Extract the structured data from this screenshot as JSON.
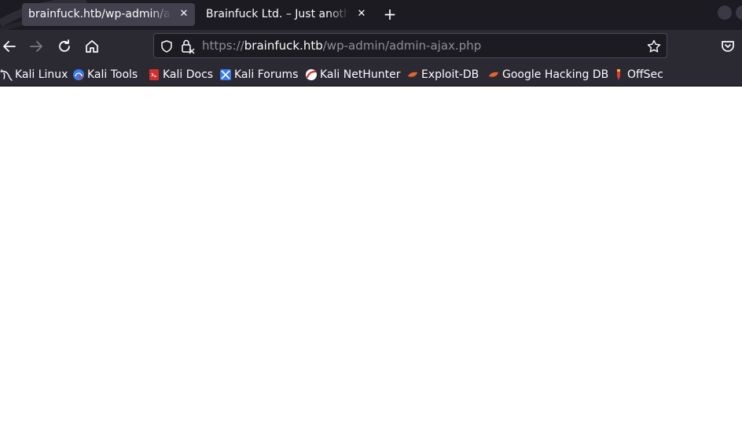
{
  "tabs": [
    {
      "title": "brainfuck.htb/wp-admin/admin-ajax.php",
      "active": true
    },
    {
      "title": "Brainfuck Ltd. – Just another WordPress site",
      "active": false
    }
  ],
  "toolbar": {
    "new_tab_icon": "plus-icon",
    "back_icon": "back-arrow-icon",
    "forward_icon": "forward-arrow-icon",
    "reload_icon": "reload-icon",
    "home_icon": "home-icon"
  },
  "urlbar": {
    "scheme": "https://",
    "host": "brainfuck.htb",
    "path": "/wp-admin/admin-ajax.php",
    "shield_icon": "shield-icon",
    "lock_icon": "insecure-lock-icon",
    "bookmark_icon": "star-icon"
  },
  "pocket_icon": "pocket-icon",
  "bookmarks": [
    {
      "label": "Kali Linux",
      "icon": "kali-dragon-icon"
    },
    {
      "label": "Kali Tools",
      "icon": "kali-tools-icon"
    },
    {
      "label": "Kali Docs",
      "icon": "kali-docs-icon"
    },
    {
      "label": "Kali Forums",
      "icon": "kali-forums-icon"
    },
    {
      "label": "Kali NetHunter",
      "icon": "nethunter-icon"
    },
    {
      "label": "Exploit-DB",
      "icon": "exploit-db-icon"
    },
    {
      "label": "Google Hacking DB",
      "icon": "ghdb-icon"
    },
    {
      "label": "OffSec",
      "icon": "offsec-icon"
    }
  ],
  "colors": {
    "chrome": "#2b2a33",
    "tabstrip": "#1c1b22",
    "active_tab": "#42414d",
    "text": "#fbfbfe",
    "url_dim": "#8f8f9d",
    "page_background": "#ffffff"
  }
}
